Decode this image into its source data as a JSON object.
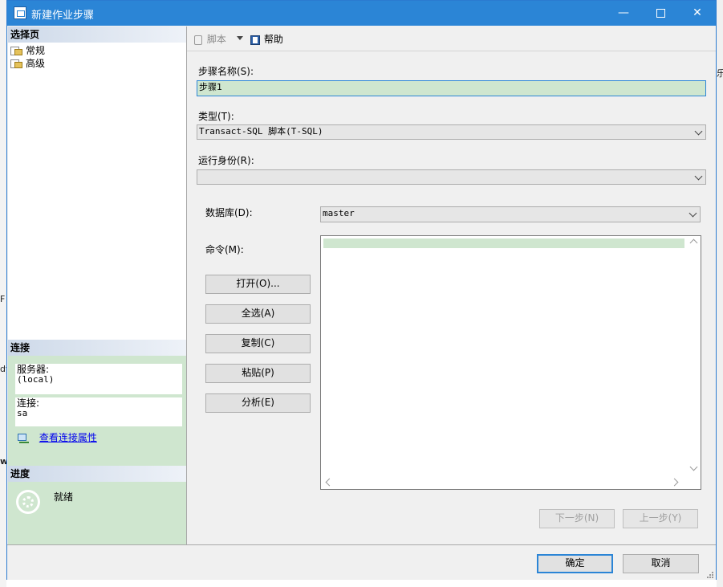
{
  "window": {
    "title": "新建作业步骤"
  },
  "left": {
    "select_page_header": "选择页",
    "pages": [
      {
        "label": "常规"
      },
      {
        "label": "高级"
      }
    ],
    "connection_header": "连接",
    "server_label": "服务器:",
    "server_value": "(local)",
    "connection_label": "连接:",
    "connection_value": "sa",
    "view_props_link": "查看连接属性",
    "progress_header": "进度",
    "progress_status": "就绪"
  },
  "toolbar": {
    "script_label": "脚本",
    "help_label": "帮助"
  },
  "form": {
    "step_name_label": "步骤名称(S):",
    "step_name_value": "步骤1",
    "type_label": "类型(T):",
    "type_value": "Transact-SQL 脚本(T-SQL)",
    "run_as_label": "运行身份(R):",
    "run_as_value": "",
    "database_label": "数据库(D):",
    "database_value": "master",
    "command_label": "命令(M):",
    "buttons": {
      "open": "打开(O)...",
      "select_all": "全选(A)",
      "copy": "复制(C)",
      "paste": "粘贴(P)",
      "parse": "分析(E)"
    }
  },
  "nav_buttons": {
    "next": "下一步(N)",
    "prev": "上一步(Y)"
  },
  "footer": {
    "ok": "确定",
    "cancel": "取消"
  },
  "background": {
    "mark_right": "乐",
    "mark_left_1": "F",
    "mark_left_2": "dy",
    "mark_left_3": "w"
  },
  "colors": {
    "titlebar": "#2b85d6",
    "highlight_green": "#cfe6cf",
    "link": "#0000ee"
  }
}
